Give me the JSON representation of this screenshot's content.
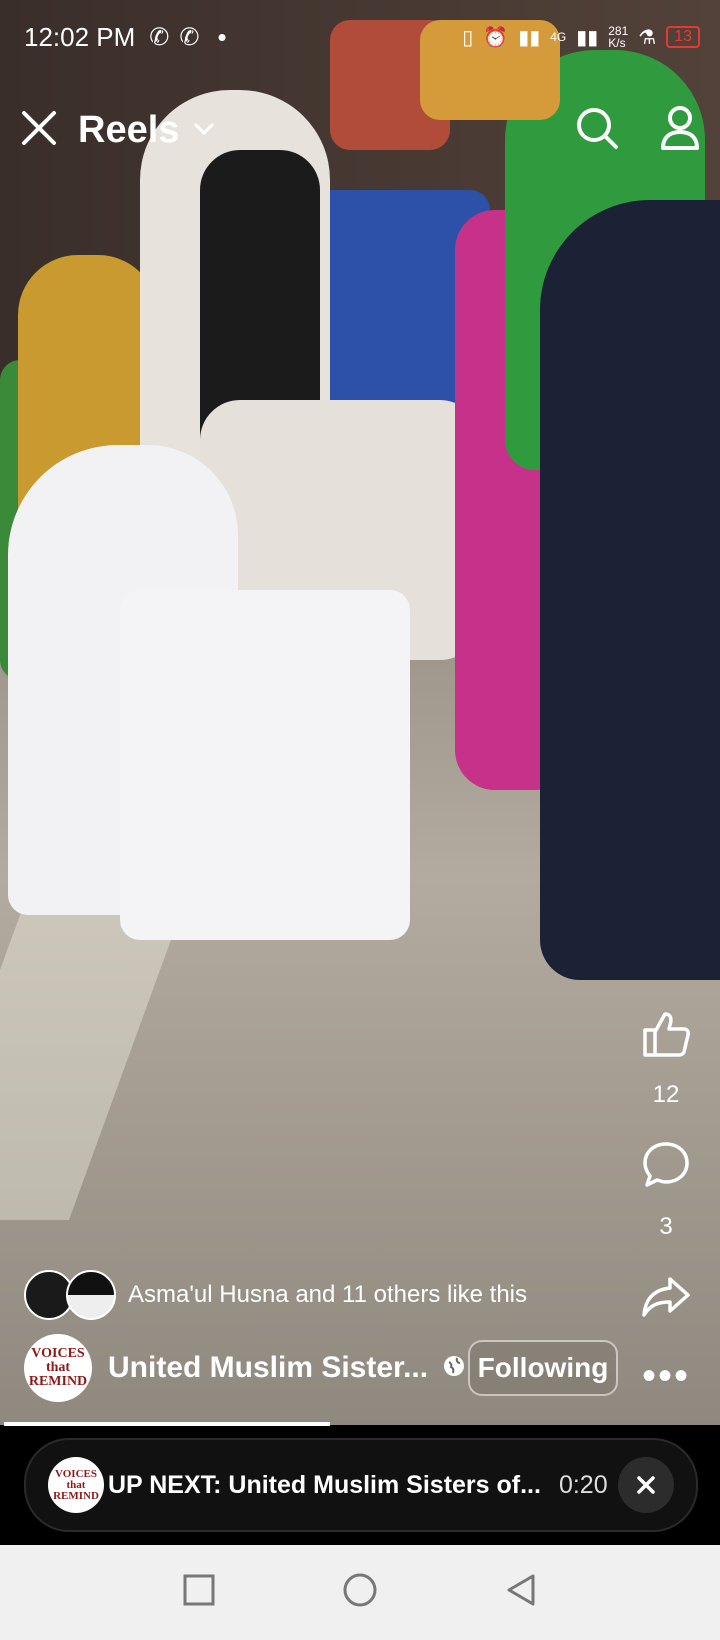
{
  "status_bar": {
    "time": "12:02 PM",
    "network": "4G",
    "speed": "281\nK/s",
    "battery": "13"
  },
  "header": {
    "title": "Reels"
  },
  "actions": {
    "like_count": "12",
    "comment_count": "3"
  },
  "likes_text": "Asma'ul Husna and 11 others like this",
  "owner": {
    "name": "United Muslim Sister...",
    "follow_label": "Following",
    "logo_text": "VOICES that REMIND"
  },
  "up_next": {
    "label": "UP NEXT: United Muslim Sisters of...",
    "duration": "0:20"
  },
  "colors": {
    "accent": "#ffffff",
    "battery_low": "#e53935",
    "progress": "#ffffff"
  }
}
